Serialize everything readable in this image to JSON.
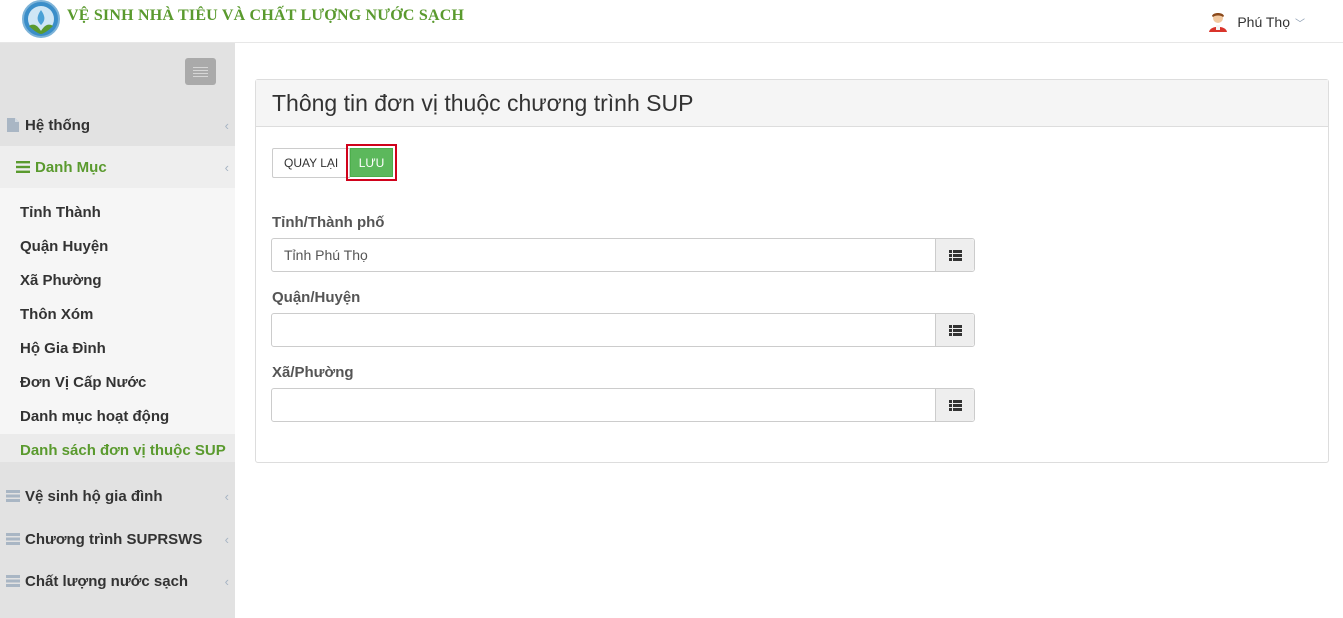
{
  "header": {
    "app_title": "VỆ SINH NHÀ TIÊU VÀ CHẤT LƯỢNG NƯỚC SẠCH",
    "user_name": "Phú Thọ",
    "accent_color": "#5a9a2e"
  },
  "sidebar": {
    "items": [
      {
        "label": "Hệ thống",
        "icon": "file-icon"
      },
      {
        "label": "Danh Mục",
        "icon": "list-icon"
      },
      {
        "label": "Vệ sinh hộ gia đình",
        "icon": "server-icon"
      },
      {
        "label": "Chương trình SUPRSWS",
        "icon": "server-icon"
      },
      {
        "label": "Chất lượng nước sạch",
        "icon": "server-icon"
      }
    ],
    "submenu": [
      {
        "label": "Tỉnh Thành"
      },
      {
        "label": "Quận Huyện"
      },
      {
        "label": "Xã Phường"
      },
      {
        "label": "Thôn Xóm"
      },
      {
        "label": "Hộ Gia Đình"
      },
      {
        "label": "Đơn Vị Cấp Nước"
      },
      {
        "label": "Danh mục hoạt động"
      },
      {
        "label": "Danh sách đơn vị thuộc SUP"
      }
    ]
  },
  "panel": {
    "title": "Thông tin đơn vị thuộc chương trình SUP",
    "back_label": "QUAY LẠI",
    "save_label": "LƯU",
    "save_color": "#5cb85c",
    "fields": [
      {
        "label": "Tỉnh/Thành phố",
        "value": "Tỉnh Phú Thọ"
      },
      {
        "label": "Quận/Huyện",
        "value": ""
      },
      {
        "label": "Xã/Phường",
        "value": ""
      }
    ]
  }
}
